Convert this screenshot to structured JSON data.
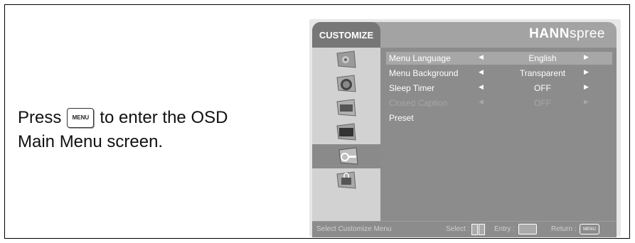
{
  "instruction": {
    "line1_before": "Press",
    "key_label": "MENU",
    "line1_after": "to enter the OSD",
    "line2": "Main Menu screen."
  },
  "osd": {
    "tab_title": "CUSTOMIZE",
    "brand_bold": "HANN",
    "brand_light": "spree",
    "side_icons": [
      "picture-icon",
      "color-icon",
      "image-icon",
      "display-icon",
      "setup-icon",
      "lock-icon"
    ],
    "active_icon_index": 4,
    "menu": [
      {
        "label": "Menu Language",
        "value": "English",
        "highlighted": true,
        "disabled": false
      },
      {
        "label": "Menu Background",
        "value": "Transparent",
        "highlighted": false,
        "disabled": false
      },
      {
        "label": "Sleep Timer",
        "value": "OFF",
        "highlighted": false,
        "disabled": false
      },
      {
        "label": "Closed Caption",
        "value": "OFF",
        "highlighted": false,
        "disabled": true
      },
      {
        "label": "Preset",
        "value": "",
        "highlighted": false,
        "disabled": false
      }
    ],
    "footer": {
      "hint": "Select Customize Menu",
      "select_label": "Select :",
      "entry_label": "Entry :",
      "return_label": "Return :",
      "return_key": "MENU"
    }
  }
}
